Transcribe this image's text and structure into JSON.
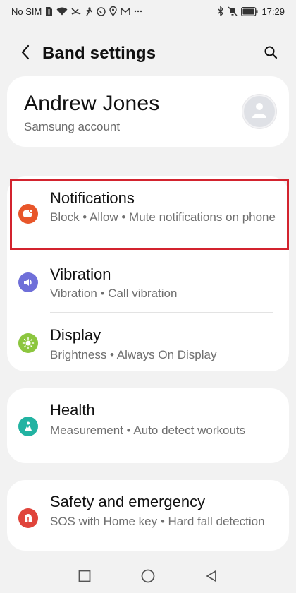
{
  "status_bar": {
    "carrier": "No SIM",
    "time": "17:29",
    "icons_left": [
      "sim-alert-icon",
      "wifi-icon",
      "missed-call-icon",
      "fitness-icon",
      "whatsapp-icon",
      "location-icon",
      "gmail-icon",
      "more-dots-icon"
    ],
    "icons_right": [
      "bluetooth-icon",
      "mute-icon",
      "battery-icon"
    ]
  },
  "header": {
    "title": "Band settings",
    "back_icon": "chevron-left-icon",
    "search_icon": "search-icon"
  },
  "account": {
    "name": "Andrew Jones",
    "subtitle": "Samsung account",
    "avatar_icon": "person-icon"
  },
  "settings": {
    "notifications": {
      "title": "Notifications",
      "subtitle": "Block  •  Allow  •  Mute notifications on phone",
      "icon": "notification-icon",
      "color": "#e8562a"
    },
    "vibration": {
      "title": "Vibration",
      "subtitle": "Vibration  •  Call vibration",
      "icon": "speaker-icon",
      "color": "#6f6fd9"
    },
    "display": {
      "title": "Display",
      "subtitle": "Brightness  •  Always On Display",
      "icon": "sun-icon",
      "color": "#8cc63f"
    },
    "health": {
      "title": "Health",
      "subtitle": "Measurement  •  Auto detect workouts",
      "icon": "health-icon",
      "color": "#22b3a2"
    },
    "safety": {
      "title": "Safety and emergency",
      "subtitle": "SOS with Home key  •  Hard fall detection",
      "icon": "emergency-icon",
      "color": "#e0443b"
    }
  },
  "highlight_color": "#d3232e",
  "nav": {
    "recents_icon": "square-icon",
    "home_icon": "circle-icon",
    "back_icon": "triangle-back-icon"
  }
}
